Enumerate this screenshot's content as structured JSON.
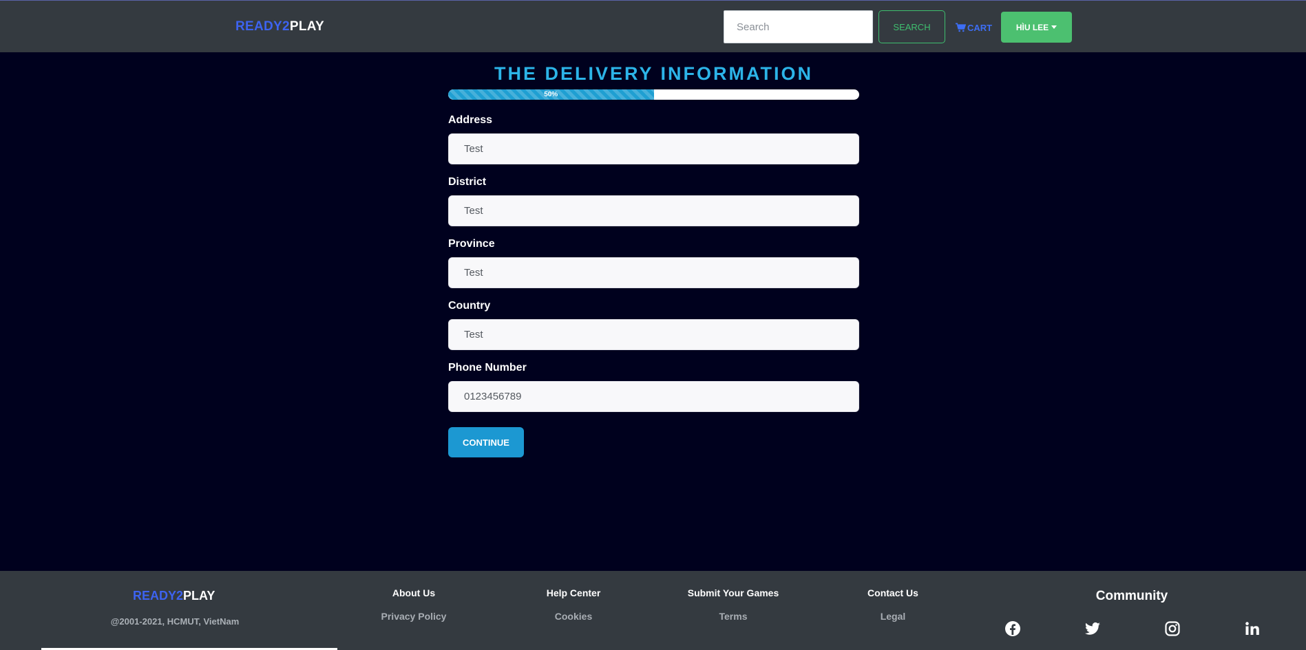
{
  "navbar": {
    "brand_part1": "READY2",
    "brand_part2": "PLAY",
    "search_placeholder": "Search",
    "search_button": "SEARCH",
    "cart_label": "CART",
    "user_label": "HÌU LEE"
  },
  "main": {
    "title": "THE DELIVERY INFORMATION",
    "progress": {
      "value": 0.5,
      "label": "50%"
    },
    "fields": {
      "address": {
        "label": "Address",
        "value": "Test"
      },
      "district": {
        "label": "District",
        "value": "Test"
      },
      "province": {
        "label": "Province",
        "value": "Test"
      },
      "country": {
        "label": "Country",
        "value": "Test"
      },
      "phone": {
        "label": "Phone Number",
        "value": "0123456789"
      }
    },
    "continue_button": "CONTINUE"
  },
  "footer": {
    "brand_part1": "READY2",
    "brand_part2": "PLAY",
    "copyright": "@2001-2021, HCMUT, VietNam",
    "columns": [
      {
        "heading": "About Us",
        "link": "Privacy Policy"
      },
      {
        "heading": "Help Center",
        "link": "Cookies"
      },
      {
        "heading": "Submit Your Games",
        "link": "Terms"
      },
      {
        "heading": "Contact Us",
        "link": "Legal"
      }
    ],
    "community_title": "Community",
    "social_icons": [
      "facebook-icon",
      "twitter-icon",
      "instagram-icon",
      "linkedin-icon"
    ]
  },
  "colors": {
    "background": "#00011e",
    "navbar": "#343a40",
    "brand_blue": "#3d63f0",
    "title_cyan": "#2cb4e8",
    "accent_green": "#4cc070",
    "button_blue": "#1c98d2"
  }
}
